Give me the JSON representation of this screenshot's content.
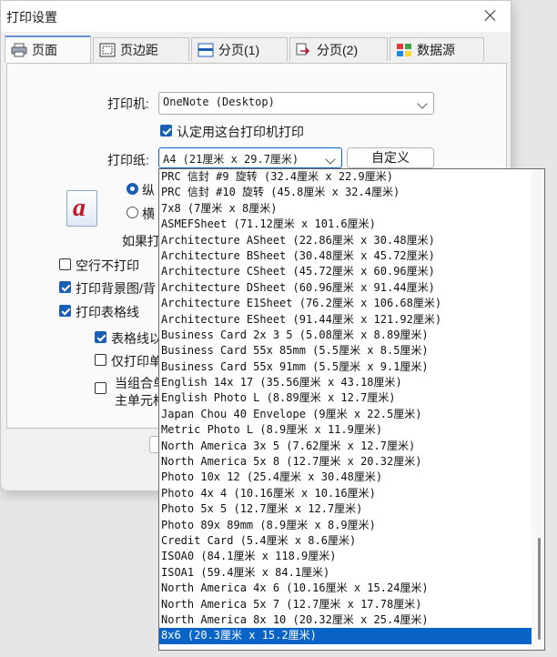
{
  "window": {
    "title": "打印设置"
  },
  "tabs": [
    {
      "label": "页面",
      "icon": "printer-icon"
    },
    {
      "label": "页边距",
      "icon": "margins-icon"
    },
    {
      "label": "分页(1)",
      "icon": "page-break-icon"
    },
    {
      "label": "分页(2)",
      "icon": "page-split-icon"
    },
    {
      "label": "数据源",
      "icon": "datasource-icon"
    }
  ],
  "page": {
    "printer_label": "打印机:",
    "printer_value": "OneNote (Desktop)",
    "default_printer_label": "认定用这台打印机打印",
    "paper_label": "打印纸:",
    "paper_value": "A4 (21厘米 x 29.7厘米)",
    "custom_button": "自定义",
    "portrait_label": "纵",
    "landscape_label": "横",
    "orientation_icon_glyph": "a",
    "if_text": "如果打",
    "skip_empty_label": "空行不打印",
    "print_background_label": "打印背景图/背",
    "print_gridlines_label": "打印表格线",
    "gridline_opt_label": "表格线以",
    "print_only_label": "仅打印单",
    "combined_line1": "当组合单",
    "combined_line2": "主单元格"
  },
  "paper_options": [
    "PRC 信封 #9 旋转 (32.4厘米 x 22.9厘米)",
    "PRC 信封 #10 旋转 (45.8厘米 x 32.4厘米)",
    "7x8 (7厘米 x 8厘米)",
    "ASMEFSheet (71.12厘米 x 101.6厘米)",
    "Architecture ASheet (22.86厘米 x 30.48厘米)",
    "Architecture BSheet (30.48厘米 x 45.72厘米)",
    "Architecture CSheet (45.72厘米 x 60.96厘米)",
    "Architecture DSheet (60.96厘米 x 91.44厘米)",
    "Architecture E1Sheet (76.2厘米 x 106.68厘米)",
    "Architecture ESheet (91.44厘米 x 121.92厘米)",
    "Business Card 2x 3 5 (5.08厘米 x 8.89厘米)",
    "Business Card 55x 85mm (5.5厘米 x 8.5厘米)",
    "Business Card 55x 91mm (5.5厘米 x 9.1厘米)",
    "English 14x 17 (35.56厘米 x 43.18厘米)",
    "English Photo L (8.89厘米 x 12.7厘米)",
    "Japan Chou 40 Envelope (9厘米 x 22.5厘米)",
    "Metric Photo L (8.9厘米 x 11.9厘米)",
    "North America 3x 5 (7.62厘米 x 12.7厘米)",
    "North America 5x 8 (12.7厘米 x 20.32厘米)",
    "Photo 10x 12 (25.4厘米 x 30.48厘米)",
    "Photo 4x 4 (10.16厘米 x 10.16厘米)",
    "Photo 5x 5 (12.7厘米 x 12.7厘米)",
    "Photo 89x 89mm (8.9厘米 x 8.9厘米)",
    "Credit Card (5.4厘米 x 8.6厘米)",
    "ISOA0 (84.1厘米 x 118.9厘米)",
    "ISOA1 (59.4厘米 x 84.1厘米)",
    "North America 4x 6 (10.16厘米 x 15.24厘米)",
    "North America 5x 7 (12.7厘米 x 17.78厘米)",
    "North America 8x 10 (20.32厘米 x 25.4厘米)",
    "8x6 (20.3厘米 x 15.2厘米)"
  ],
  "selected_index": 29,
  "colors": {
    "selection": "#0a64c8",
    "accent": "#1a5fb4"
  }
}
